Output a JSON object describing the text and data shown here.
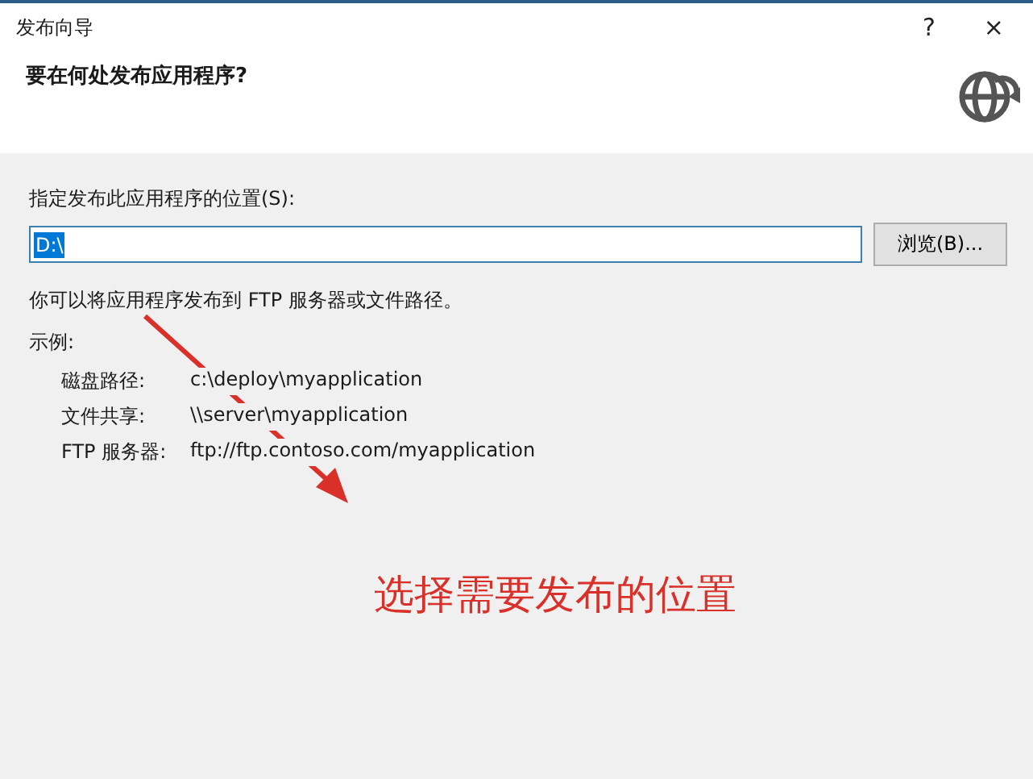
{
  "window": {
    "title": "发布向导",
    "help": "?",
    "close": "×"
  },
  "header": {
    "title": "要在何处发布应用程序?"
  },
  "location": {
    "label": "指定发布此应用程序的位置(S):",
    "value": "D:\\",
    "value_selected": true,
    "browse": "浏览(B)..."
  },
  "hint": "你可以将应用程序发布到 FTP 服务器或文件路径。",
  "examples": {
    "heading": "示例:",
    "rows": [
      {
        "label": "磁盘路径:",
        "value": "c:\\deploy\\myapplication"
      },
      {
        "label": "文件共享:",
        "value": "\\\\server\\myapplication"
      },
      {
        "label": "FTP 服务器:",
        "value": "ftp://ftp.contoso.com/myapplication"
      }
    ]
  },
  "annotation": {
    "text": "选择需要发布的位置"
  }
}
